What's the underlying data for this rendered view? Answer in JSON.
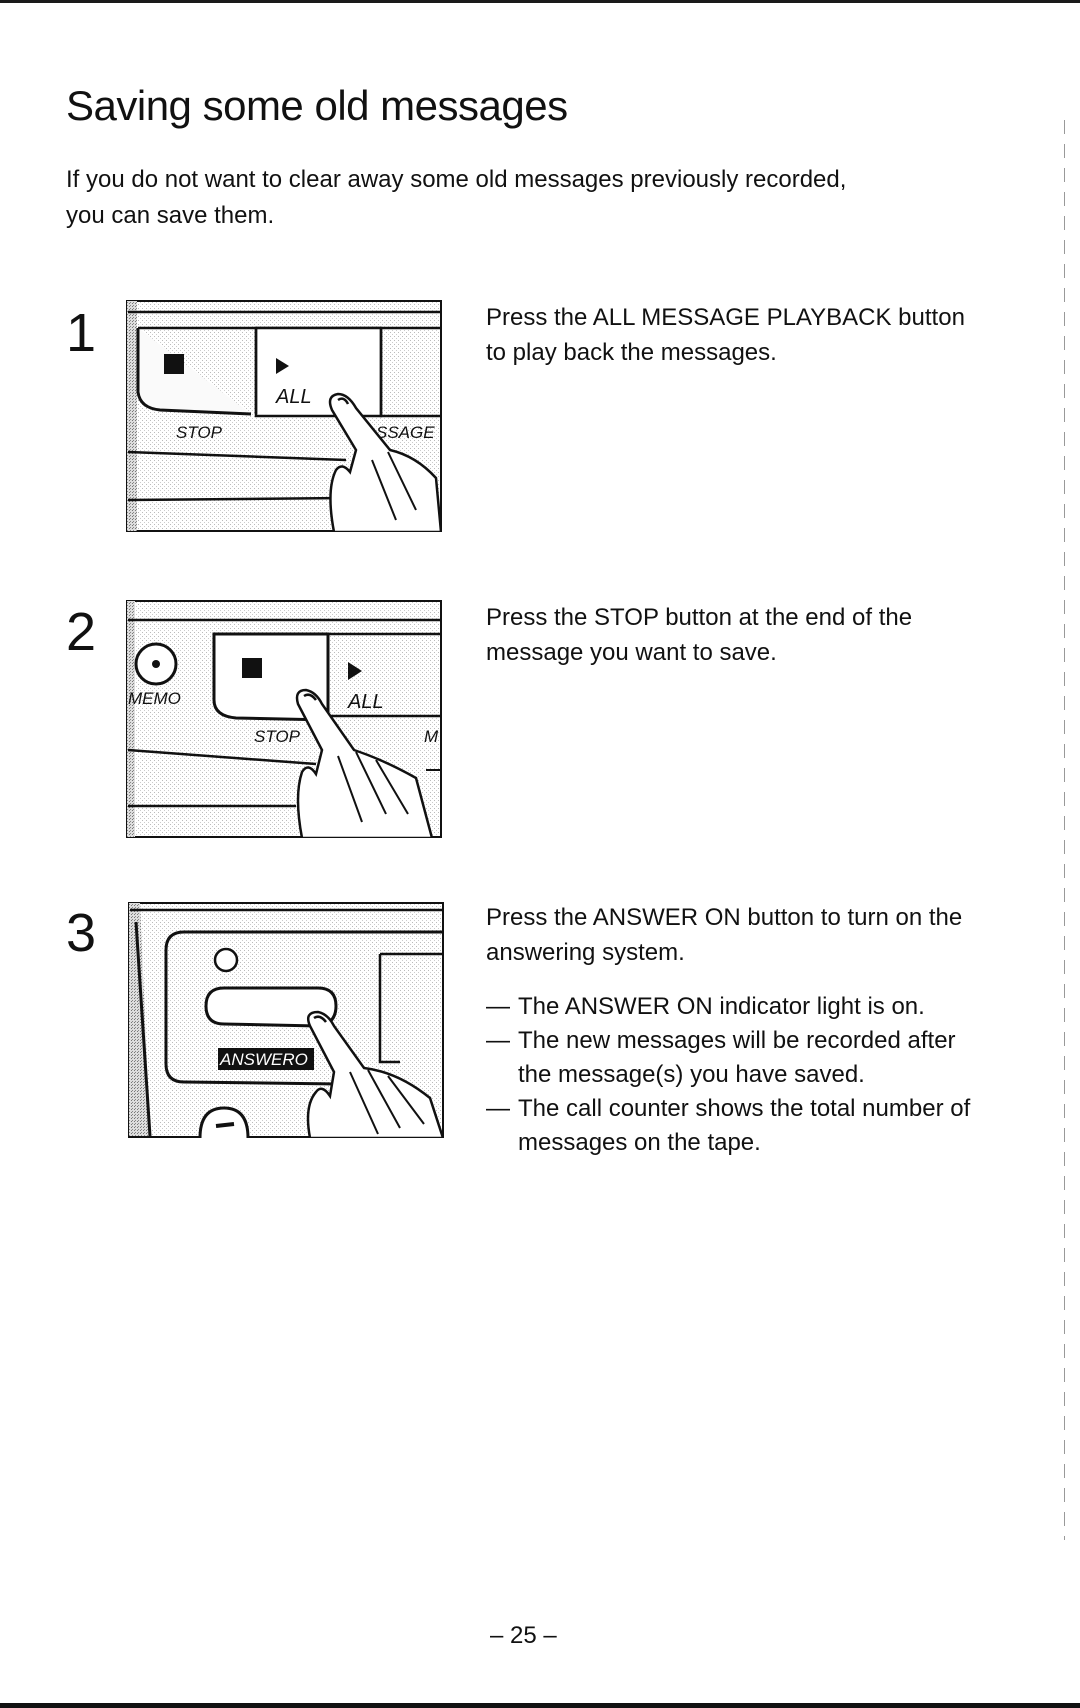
{
  "page": {
    "title": "Saving some old messages",
    "intro": "If you do not want to clear away some old messages previously recorded, you can save them.",
    "page_number": "– 25 –"
  },
  "steps": [
    {
      "number": "1",
      "text": "Press the ALL MESSAGE PLAYBACK button to play back the messages.",
      "illustration": {
        "description": "finger pressing ALL button",
        "labels": {
          "stop": "STOP",
          "all": "ALL",
          "message_partial": "SSAGE"
        },
        "icons": [
          "stop-square-icon",
          "play-triangle-icon",
          "pointing-hand-icon"
        ]
      }
    },
    {
      "number": "2",
      "text": "Press the STOP button at the end of the message you want to save.",
      "illustration": {
        "description": "finger pressing STOP button",
        "labels": {
          "memo": "MEMO",
          "stop": "STOP",
          "all": "ALL",
          "message_partial": "M"
        },
        "icons": [
          "memo-record-icon",
          "stop-square-icon",
          "play-triangle-icon",
          "pointing-hand-icon"
        ]
      }
    },
    {
      "number": "3",
      "text": "Press the ANSWER ON button to turn on the answering system.",
      "notes": [
        "The ANSWER ON indicator light is on.",
        "The new messages will be recorded after the message(s) you have saved.",
        "The call counter shows the total number of messages on the tape."
      ],
      "note_dash": "—",
      "illustration": {
        "description": "finger pressing ANSWER ON button",
        "labels": {
          "answer_on_partial": "ANSWERO"
        },
        "icons": [
          "indicator-light-icon",
          "pointing-hand-icon"
        ]
      }
    }
  ]
}
